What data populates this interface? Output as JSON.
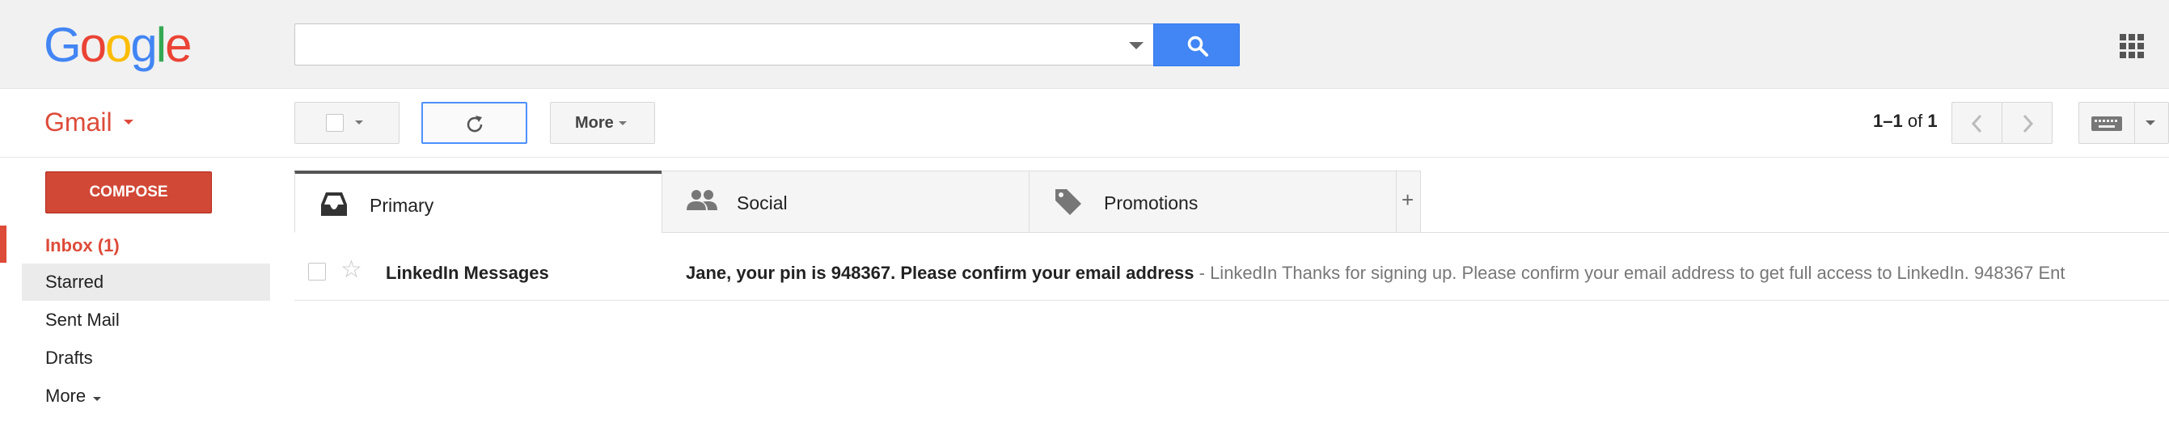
{
  "header": {
    "logo_letters": [
      {
        "char": "G",
        "color": "#4285f4"
      },
      {
        "char": "o",
        "color": "#ea4335"
      },
      {
        "char": "o",
        "color": "#fbbc05"
      },
      {
        "char": "g",
        "color": "#4285f4"
      },
      {
        "char": "l",
        "color": "#34a853"
      },
      {
        "char": "e",
        "color": "#ea4335"
      }
    ],
    "search": {
      "value": "",
      "placeholder": ""
    },
    "search_icon": "search-icon",
    "apps_icon": "apps-grid-icon"
  },
  "toolbar": {
    "app_label": "Gmail",
    "more_label": "More",
    "pager": {
      "range": "1–1",
      "of": "of",
      "total": "1"
    }
  },
  "sidebar": {
    "compose_label": "COMPOSE",
    "items": [
      {
        "label": "Inbox (1)"
      },
      {
        "label": "Starred"
      },
      {
        "label": "Sent Mail"
      },
      {
        "label": "Drafts"
      },
      {
        "label": "More"
      }
    ]
  },
  "tabs": [
    {
      "label": "Primary",
      "icon": "inbox-icon",
      "active": true
    },
    {
      "label": "Social",
      "icon": "people-icon"
    },
    {
      "label": "Promotions",
      "icon": "tag-icon"
    }
  ],
  "add_tab_label": "+",
  "messages": [
    {
      "sender": "LinkedIn Messages",
      "subject": "Jane, your pin is 948367. Please confirm your email address",
      "snippet": " - LinkedIn Thanks for signing up. Please confirm your email address to get full access to LinkedIn. 948367 Ent"
    }
  ],
  "colors": {
    "accent_red": "#dd4b39",
    "compose_red": "#d14836",
    "search_blue": "#4285f4"
  }
}
